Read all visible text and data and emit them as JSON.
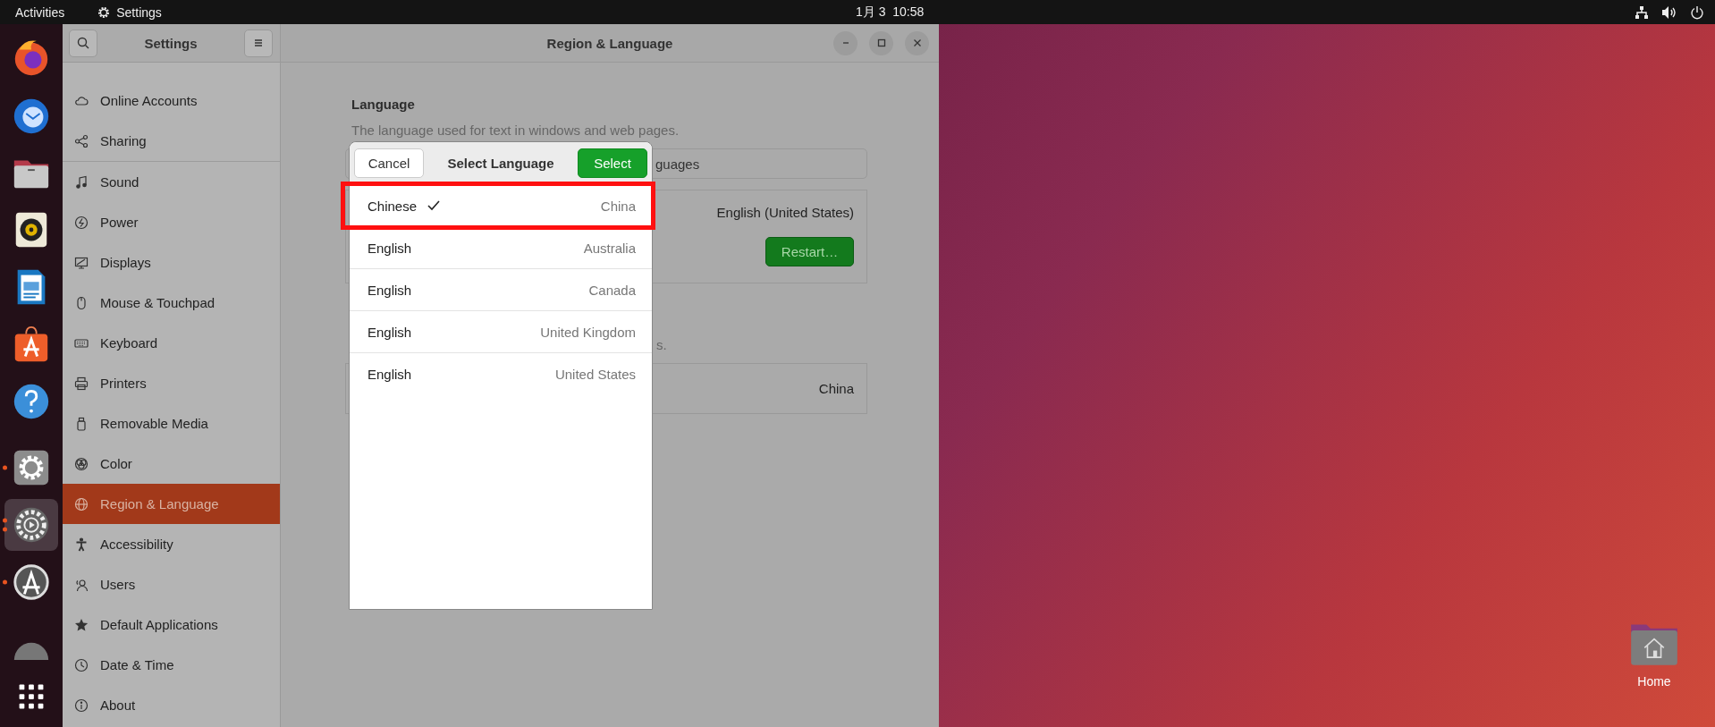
{
  "top_bar": {
    "activities": "Activities",
    "app_name": "Settings",
    "clock": "1月 3  10:58"
  },
  "dock": {
    "favorites": [
      {
        "kind": "browser",
        "running": false,
        "selected": false
      },
      {
        "kind": "mail",
        "running": false,
        "selected": false
      },
      {
        "kind": "folder",
        "running": false,
        "selected": false
      },
      {
        "kind": "speaker",
        "running": false,
        "selected": false
      },
      {
        "kind": "document",
        "running": false,
        "selected": false
      },
      {
        "kind": "bag",
        "running": false,
        "selected": false
      },
      {
        "kind": "help",
        "running": false,
        "selected": false
      }
    ],
    "others": [
      {
        "kind": "gear",
        "running": true,
        "multiple_windows": false,
        "selected": false
      },
      {
        "kind": "gear-play",
        "running": true,
        "multiple_windows": true,
        "selected": true
      },
      {
        "kind": "updater",
        "running": true,
        "multiple_windows": false,
        "selected": false
      },
      {
        "kind": "disc",
        "running": false,
        "selected": false
      },
      {
        "kind": "grid",
        "running": false,
        "selected": false
      }
    ]
  },
  "window": {
    "sidebar_title": "Settings",
    "title": "Region & Language"
  },
  "sidebar": {
    "groups": [
      [
        {
          "label": "Online Accounts",
          "kind": "cloud",
          "selected": false
        },
        {
          "label": "Sharing",
          "kind": "share",
          "selected": false
        }
      ],
      [
        {
          "label": "Sound",
          "kind": "note",
          "selected": false
        },
        {
          "label": "Power",
          "kind": "bolt",
          "selected": false
        },
        {
          "label": "Displays",
          "kind": "monitor",
          "selected": false
        },
        {
          "label": "Mouse & Touchpad",
          "kind": "mouse",
          "selected": false
        },
        {
          "label": "Keyboard",
          "kind": "keyboard",
          "selected": false
        },
        {
          "label": "Printers",
          "kind": "printer",
          "selected": false
        },
        {
          "label": "Removable Media",
          "kind": "usb",
          "selected": false
        },
        {
          "label": "Color",
          "kind": "color",
          "selected": false
        },
        {
          "label": "Region & Language",
          "kind": "globe",
          "selected": true
        },
        {
          "label": "Accessibility",
          "kind": "person",
          "selected": false
        },
        {
          "label": "Users",
          "kind": "users",
          "selected": false
        },
        {
          "label": "Default Applications",
          "kind": "star",
          "selected": false
        },
        {
          "label": "Date & Time",
          "kind": "clock",
          "selected": false
        },
        {
          "label": "About",
          "kind": "info",
          "selected": false
        }
      ]
    ]
  },
  "main": {
    "language": {
      "heading": "Language",
      "description": "The language used for text in windows and web pages.",
      "field_text": "guages",
      "current": "English (United States)",
      "restart": "Restart…"
    },
    "formats": {
      "description_tail": "s.",
      "current": "China"
    }
  },
  "dialog": {
    "cancel": "Cancel",
    "title": "Select Language",
    "select": "Select",
    "options": [
      {
        "language": "Chinese",
        "region": "China",
        "selected": true,
        "highlighted": true
      },
      {
        "language": "English",
        "region": "Australia",
        "selected": false,
        "highlighted": false
      },
      {
        "language": "English",
        "region": "Canada",
        "selected": false,
        "highlighted": false
      },
      {
        "language": "English",
        "region": "United Kingdom",
        "selected": false,
        "highlighted": false
      },
      {
        "language": "English",
        "region": "United States",
        "selected": false,
        "highlighted": false
      }
    ]
  },
  "desktop": {
    "icons": [
      {
        "label": "Home"
      }
    ]
  }
}
